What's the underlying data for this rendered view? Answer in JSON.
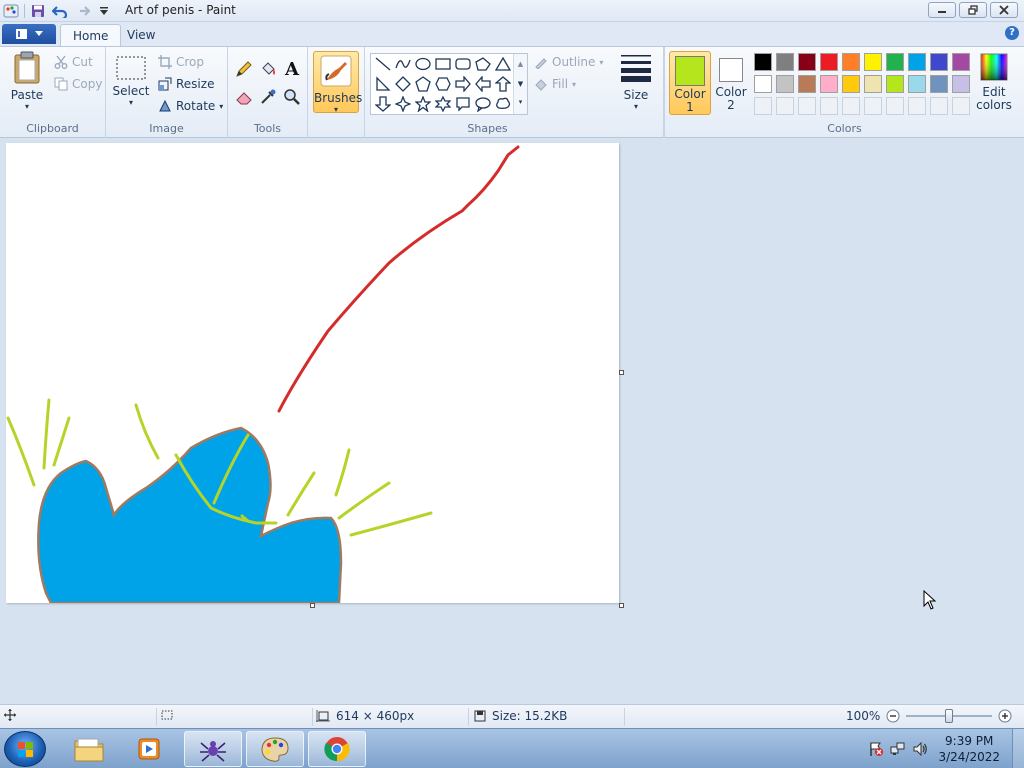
{
  "window": {
    "title": "Art of penis - Paint"
  },
  "tabs": [
    {
      "label": "Home"
    },
    {
      "label": "View"
    }
  ],
  "clipboard": {
    "paste": "Paste",
    "cut": "Cut",
    "copy": "Copy",
    "label": "Clipboard"
  },
  "image": {
    "select": "Select",
    "crop": "Crop",
    "resize": "Resize",
    "rotate": "Rotate",
    "label": "Image"
  },
  "tools": {
    "label": "Tools",
    "text_glyph": "A"
  },
  "brushes": {
    "label": "Brushes"
  },
  "shapes": {
    "label": "Shapes",
    "outline": "Outline",
    "fill": "Fill"
  },
  "size": {
    "label": "Size"
  },
  "colors": {
    "label": "Colors",
    "color1_line1": "Color",
    "color1_line2": "1",
    "color2_line1": "Color",
    "color2_line2": "2",
    "edit_line1": "Edit",
    "edit_line2": "colors",
    "color1_value": "#b5e61d",
    "color2_value": "#ffffff",
    "palette_row1": [
      "#000000",
      "#7f7f7f",
      "#880015",
      "#ed1c24",
      "#ff7f27",
      "#fff200",
      "#22b14c",
      "#00a2e8",
      "#3f48cc",
      "#a349a4"
    ],
    "palette_row2": [
      "#ffffff",
      "#c3c3c3",
      "#b97a57",
      "#ffaec9",
      "#ffc90e",
      "#efe4b0",
      "#b5e61d",
      "#99d9ea",
      "#7092be",
      "#c8bfe7"
    ]
  },
  "canvas": {
    "stroke_red": "#d42b2b",
    "stroke_green": "#b5d42a",
    "fill_blue": "#00a2e8",
    "outline_brown": "#a07a60"
  },
  "status": {
    "dimensions": "614 × 460px",
    "size": "Size: 15.2KB",
    "zoom": "100%",
    "zoom_level_percent": 100
  },
  "taskbar": {
    "time": "9:39 PM",
    "date": "3/24/2022"
  }
}
